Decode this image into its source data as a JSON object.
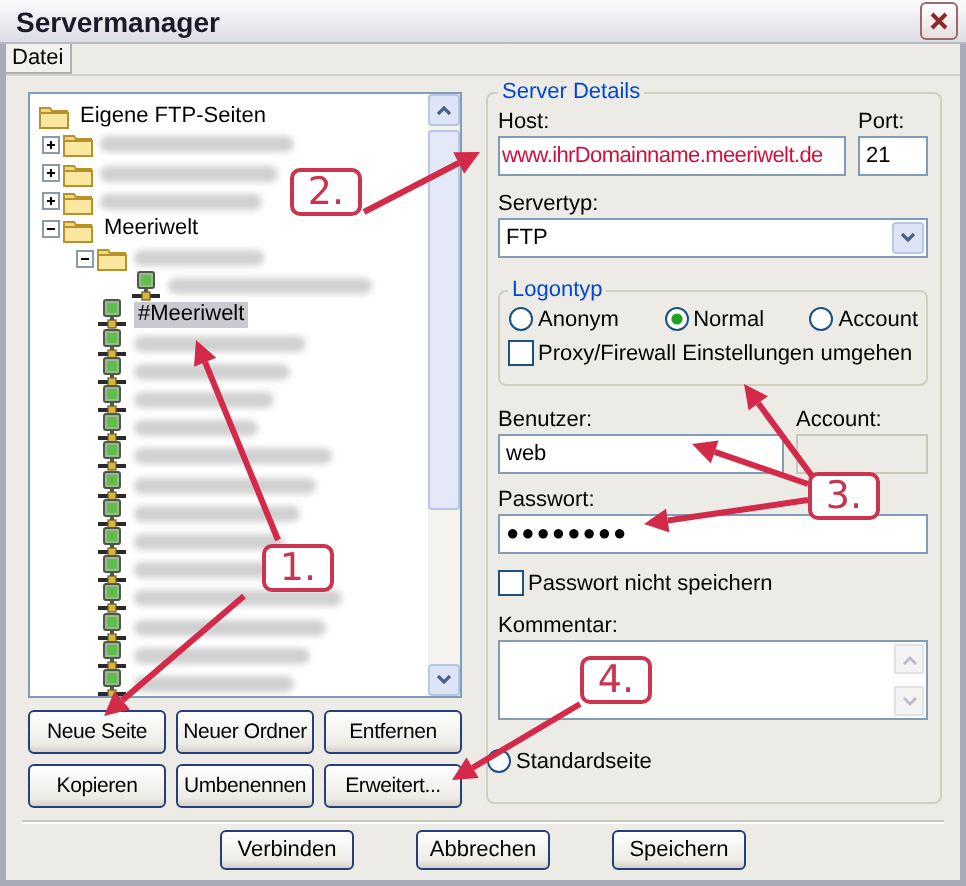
{
  "window": {
    "title": "Servermanager"
  },
  "menu": [
    {
      "label": "Datei"
    }
  ],
  "tree": {
    "label": "Eigene FTP-Seiten",
    "kind": "folder",
    "selected": false,
    "children": [
      {
        "kind": "folder",
        "redacted": true,
        "expanded": false,
        "selected": false
      },
      {
        "kind": "folder",
        "redacted": true,
        "expanded": false,
        "selected": false
      },
      {
        "kind": "folder",
        "redacted": true,
        "expanded": false,
        "selected": false
      },
      {
        "label": "Meeriwelt",
        "kind": "folder",
        "expanded": true,
        "selected": false,
        "children": [
          {
            "kind": "folder",
            "redacted": true,
            "expanded": true,
            "selected": false,
            "children": [
              {
                "kind": "server",
                "redacted": true,
                "selected": false
              }
            ]
          },
          {
            "label": "#Meeriwelt",
            "kind": "server",
            "selected": true
          },
          {
            "kind": "server",
            "redacted": true,
            "selected": false
          },
          {
            "kind": "server",
            "redacted": true,
            "selected": false
          },
          {
            "kind": "server",
            "redacted": true,
            "selected": false
          },
          {
            "kind": "server",
            "redacted": true,
            "selected": false
          },
          {
            "kind": "server",
            "redacted": true,
            "selected": false
          },
          {
            "kind": "server",
            "redacted": true,
            "selected": false
          },
          {
            "kind": "server",
            "redacted": true,
            "selected": false
          },
          {
            "kind": "server",
            "redacted": true,
            "selected": false
          },
          {
            "kind": "server",
            "redacted": true,
            "selected": false
          },
          {
            "kind": "server",
            "redacted": true,
            "selected": false
          },
          {
            "kind": "server",
            "redacted": true,
            "selected": false
          },
          {
            "kind": "server",
            "redacted": true,
            "selected": false
          },
          {
            "kind": "server",
            "redacted": true,
            "selected": false
          }
        ]
      }
    ]
  },
  "left_buttons": [
    "Neue Seite",
    "Neuer Ordner",
    "Entfernen",
    "Kopieren",
    "Umbenennen",
    "Erweitert..."
  ],
  "server_details": {
    "title": "Server Details",
    "host": {
      "label": "Host:",
      "value": "www.ihrDomainname.meeriwelt.de"
    },
    "port": {
      "label": "Port:",
      "value": "21"
    },
    "server_type": {
      "label": "Servertyp:",
      "value": "FTP"
    },
    "logon_type": {
      "title": "Logontyp",
      "options": [
        {
          "label": "Anonym",
          "selected": false
        },
        {
          "label": "Normal",
          "selected": true
        },
        {
          "label": "Account",
          "selected": false
        }
      ],
      "bypass_proxy": {
        "label": "Proxy/Firewall Einstellungen umgehen",
        "checked": false
      }
    },
    "user": {
      "label": "Benutzer:",
      "value": "web"
    },
    "account": {
      "label": "Account:",
      "disabled": true
    },
    "password": {
      "label": "Passwort:",
      "value": "●●●●●●●●"
    },
    "dont_save_password": {
      "label": "Passwort nicht speichern",
      "checked": false
    },
    "comment": {
      "label": "Kommentar:"
    },
    "default_site": {
      "label": "Standardseite",
      "selected": false
    }
  },
  "bottom_buttons": [
    "Verbinden",
    "Abbrechen",
    "Speichern"
  ],
  "annotations": [
    {
      "label": "1."
    },
    {
      "label": "2."
    },
    {
      "label": "3."
    },
    {
      "label": "4."
    }
  ]
}
